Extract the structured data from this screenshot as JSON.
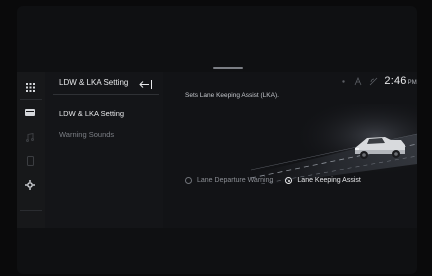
{
  "sidebar": {
    "items": [
      {
        "icon": "apps-grid-icon",
        "state": "active"
      },
      {
        "icon": "vehicle-card-icon",
        "state": "active"
      },
      {
        "icon": "music-note-icon",
        "state": "dim"
      },
      {
        "icon": "phone-icon",
        "state": "dim"
      },
      {
        "icon": "settings-gear-icon",
        "state": "active"
      }
    ]
  },
  "panel": {
    "title": "LDW & LKA Setting",
    "back_icon": "back-arrow-icon",
    "menu": [
      {
        "label": "LDW & LKA Setting",
        "selected": true
      },
      {
        "label": "Warning Sounds",
        "selected": false
      }
    ]
  },
  "status": {
    "icons": [
      "signal-icon",
      "connectivity-icon",
      "wifi-icon"
    ],
    "time": "2:46",
    "ampm": "PM"
  },
  "content": {
    "description": "Sets Lane Keeping Assist (LKA).",
    "options": [
      {
        "label": "Lane Departure Warning",
        "selected": false
      },
      {
        "label": "Lane Keeping Assist",
        "selected": true
      }
    ]
  },
  "colors": {
    "background": "#0f1012",
    "panel": "#141518",
    "text": "#e8e9eb",
    "muted": "#7c7f85"
  }
}
